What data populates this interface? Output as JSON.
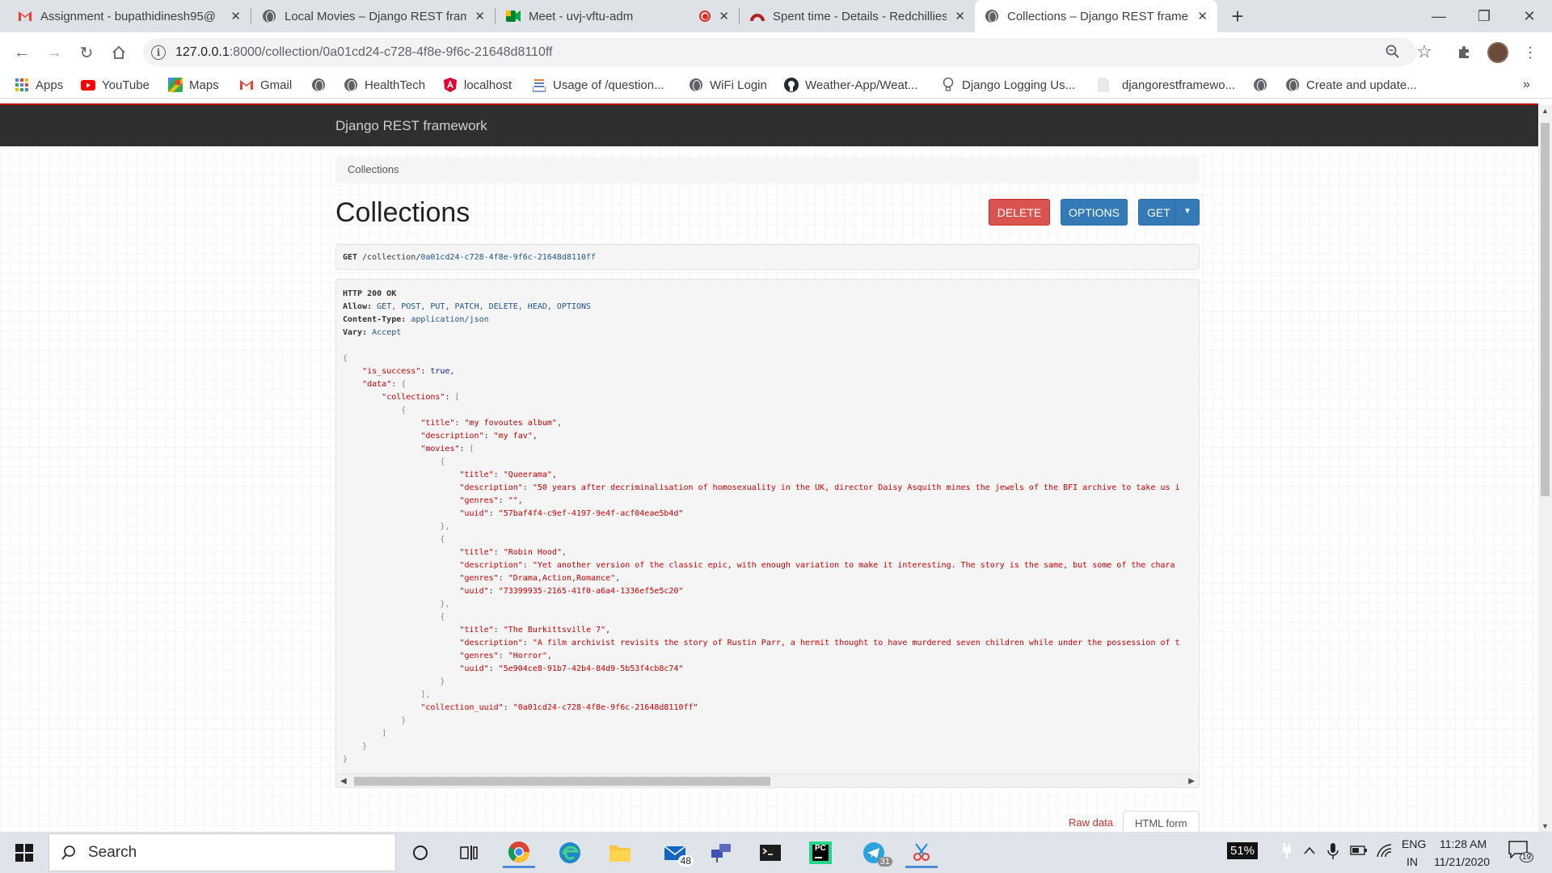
{
  "browser": {
    "tabs": [
      {
        "title": "Assignment - bupathidinesh95@",
        "icon": "gmail-icon"
      },
      {
        "title": "Local Movies – Django REST fram",
        "icon": "globe-icon"
      },
      {
        "title": "Meet - uvj-vftu-adm",
        "icon": "meet-icon",
        "recording": true
      },
      {
        "title": "Spent time - Details - Redchillies",
        "icon": "redmine-icon"
      },
      {
        "title": "Collections – Django REST frame",
        "icon": "globe-icon",
        "active": true
      }
    ],
    "url_host": "127.0.0.1",
    "url_path": ":8000/collection/0a01cd24-c728-4f8e-9f6c-21648d8110ff",
    "bookmarks": [
      {
        "label": "Apps",
        "icon": "apps-grid-icon"
      },
      {
        "label": "YouTube",
        "icon": "youtube-icon"
      },
      {
        "label": "Maps",
        "icon": "maps-icon"
      },
      {
        "label": "Gmail",
        "icon": "gmail-icon"
      },
      {
        "label": "",
        "icon": "globe-icon"
      },
      {
        "label": "HealthTech",
        "icon": "globe-icon"
      },
      {
        "label": "localhost",
        "icon": "angular-icon"
      },
      {
        "label": "Usage of /question...",
        "icon": "stackoverflow-icon"
      },
      {
        "label": "WiFi Login",
        "icon": "globe-icon"
      },
      {
        "label": "Weather-App/Weat...",
        "icon": "github-icon"
      },
      {
        "label": "Django Logging Us...",
        "icon": "bulb-icon"
      },
      {
        "label": "djangorestframewo...",
        "icon": "page-icon"
      },
      {
        "label": "",
        "icon": "globe-icon"
      },
      {
        "label": "Create and update...",
        "icon": "globe-icon"
      }
    ]
  },
  "drf": {
    "brand": "Django REST framework",
    "breadcrumb": "Collections",
    "title": "Collections",
    "buttons": {
      "delete": "DELETE",
      "options": "OPTIONS",
      "get": "GET"
    },
    "request": {
      "method": "GET",
      "path": "/collection/",
      "id": "0a01cd24-c728-4f8e-9f6c-21648d8110ff"
    },
    "response_headers": {
      "status": "HTTP 200 OK",
      "allow_label": "Allow:",
      "allow": "GET, POST, PUT, PATCH, DELETE, HEAD, OPTIONS",
      "content_type_label": "Content-Type:",
      "content_type": "application/json",
      "vary_label": "Vary:",
      "vary": "Accept"
    },
    "response_body": {
      "is_success": true,
      "collection_title": "my fovoutes album",
      "collection_description": "my fav",
      "movies": [
        {
          "title": "Queerama",
          "description": "50 years after decriminalisation of homosexuality in the UK, director Daisy Asquith mines the jewels of the BFI archive to take us i",
          "genres": "",
          "uuid": "57baf4f4-c9ef-4197-9e4f-acf04eae5b4d"
        },
        {
          "title": "Robin Hood",
          "description": "Yet another version of the classic epic, with enough variation to make it interesting. The story is the same, but some of the chara",
          "genres": "Drama,Action,Romance",
          "uuid": "73399935-2165-41f0-a6a4-1336ef5e5c20"
        },
        {
          "title": "The Burkittsville 7",
          "description": "A film archivist revisits the story of Rustin Parr, a hermit thought to have murdered seven children while under the possession of t",
          "genres": "Horror",
          "uuid": "5e904ce8-91b7-42b4-84d9-5b53f4cb8c74"
        }
      ],
      "collection_uuid": "0a01cd24-c728-4f8e-9f6c-21648d8110ff"
    },
    "form_tabs": {
      "raw": "Raw data",
      "html": "HTML form"
    }
  },
  "taskbar": {
    "search_placeholder": "Search",
    "mail_badge": "48",
    "telegram_badge": "31",
    "battery": "51%",
    "lang1": "ENG",
    "lang2": "IN",
    "time": "11:28 AM",
    "date": "11/21/2020",
    "notif_count": "19"
  }
}
